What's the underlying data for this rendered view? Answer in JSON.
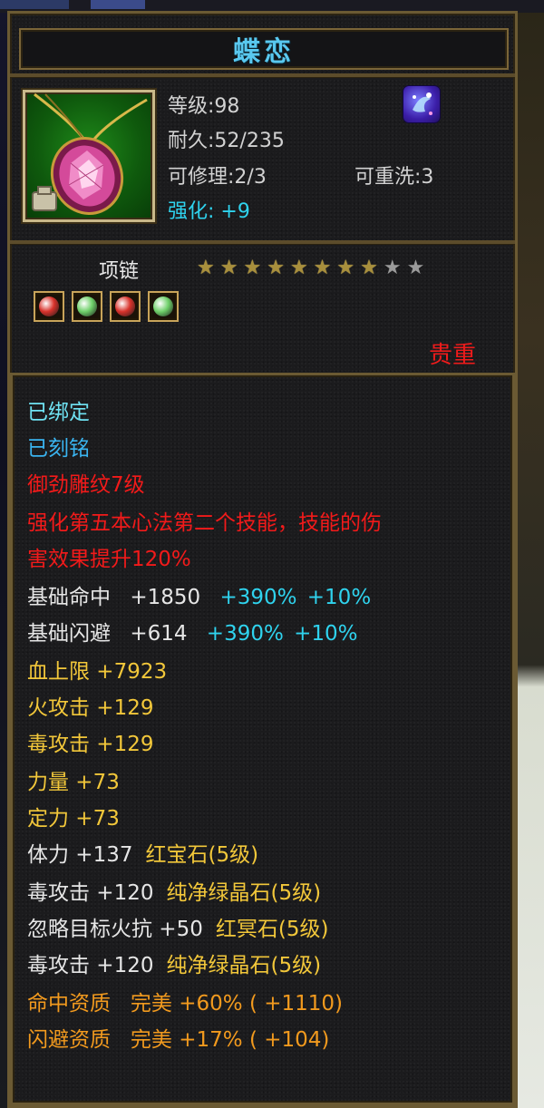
{
  "colors": {
    "title": "#59c8ef",
    "cyan": "#2fd3ee",
    "red": "#f21a1a",
    "gold": "#f2c73a",
    "orange": "#f29a1e",
    "border": "#6b5a33"
  },
  "item": {
    "name": "蝶恋",
    "level_label": "等级:98",
    "durability_label": "耐久:52/235",
    "repair_label": "可修理:2/3",
    "rewash_label": "可重洗:3",
    "enhance_label": "强化:",
    "enhance_value": "+9",
    "category": "项链",
    "star_rating": 8,
    "star_max": 10,
    "quality": "贵重",
    "icon": "pink-gem-necklace-icon",
    "badge_icon": "star-crystal-icon"
  },
  "gems": [
    {
      "name": "red-gem-icon",
      "color": "#d8322b"
    },
    {
      "name": "green-gem-icon",
      "color": "#6fd06a"
    },
    {
      "name": "red-gem-icon",
      "color": "#d8322b"
    },
    {
      "name": "green-gem-icon",
      "color": "#6fd06a"
    }
  ],
  "details": {
    "bound": "已绑定",
    "engraved": "已刻铭",
    "carving": "御劲雕纹7级",
    "skill_line1": "强化第五本心法第二个技能，技能的伤",
    "skill_line2": "害效果提升120%",
    "hit": {
      "label": "基础命中",
      "value": "+1850",
      "bonus1": "+390%",
      "bonus2": "+10%"
    },
    "dodge": {
      "label": "基础闪避",
      "value": "+614",
      "bonus1": "+390%",
      "bonus2": "+10%"
    },
    "hp": "血上限 +7923",
    "fire_atk": "火攻击 +129",
    "poison_atk": "毒攻击 +129",
    "strength": "力量 +73",
    "focus": "定力 +73",
    "gem_stats": [
      {
        "stat": "体力 +137",
        "gem": "红宝石(5级)"
      },
      {
        "stat": "毒攻击 +120",
        "gem": "纯净绿晶石(5级)"
      },
      {
        "stat": "忽略目标火抗 +50",
        "gem": "红冥石(5级)"
      },
      {
        "stat": "毒攻击 +120",
        "gem": "纯净绿晶石(5级)"
      }
    ],
    "aptitude_hit": "命中资质   完美 +60% ( +1110)",
    "aptitude_dodge": "闪避资质   完美 +17% ( +104)"
  }
}
